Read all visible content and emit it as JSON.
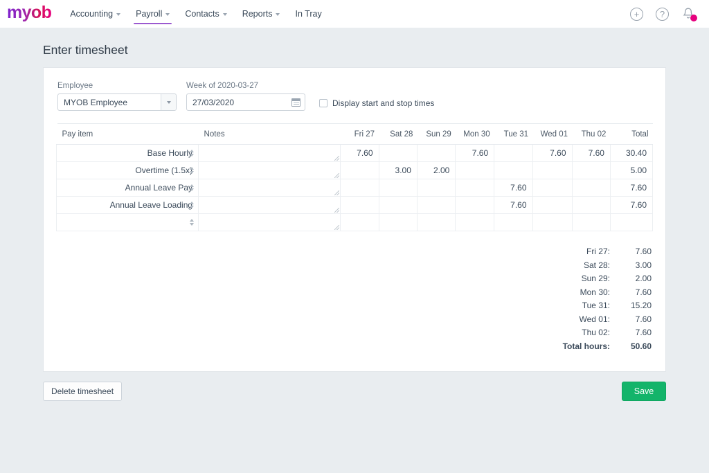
{
  "nav": {
    "logo": "myob",
    "items": [
      {
        "label": "Accounting",
        "has_chevron": true,
        "active": false
      },
      {
        "label": "Payroll",
        "has_chevron": true,
        "active": true
      },
      {
        "label": "Contacts",
        "has_chevron": true,
        "active": false
      },
      {
        "label": "Reports",
        "has_chevron": true,
        "active": false
      },
      {
        "label": "In Tray",
        "has_chevron": false,
        "active": false
      }
    ],
    "add_icon": "+",
    "help_icon": "?",
    "accent_active": "#9b59d0",
    "notification_color": "#e6007e"
  },
  "page": {
    "title": "Enter timesheet"
  },
  "filters": {
    "employee_label": "Employee",
    "employee_value": "MYOB Employee",
    "week_label": "Week of 2020-03-27",
    "date_value": "27/03/2020",
    "date_placeholder": "dd/mm/yyyy",
    "checkbox_label": "Display start and stop times",
    "checkbox_checked": false
  },
  "table": {
    "headers": [
      "Pay item",
      "Notes",
      "Fri 27",
      "Sat 28",
      "Sun 29",
      "Mon 30",
      "Tue 31",
      "Wed 01",
      "Thu 02",
      "Total"
    ],
    "rows": [
      {
        "pay_item": "Base Hourly",
        "notes": "",
        "days": [
          "7.60",
          "",
          "",
          "7.60",
          "",
          "7.60",
          "7.60"
        ],
        "total": "30.40"
      },
      {
        "pay_item": "Overtime (1.5x)",
        "notes": "",
        "days": [
          "",
          "3.00",
          "2.00",
          "",
          "",
          "",
          ""
        ],
        "total": "5.00"
      },
      {
        "pay_item": "Annual Leave Pay",
        "notes": "",
        "days": [
          "",
          "",
          "",
          "",
          "7.60",
          "",
          ""
        ],
        "total": "7.60"
      },
      {
        "pay_item": "Annual Leave Loading",
        "notes": "",
        "days": [
          "",
          "",
          "",
          "",
          "7.60",
          "",
          ""
        ],
        "total": "7.60"
      },
      {
        "pay_item": "",
        "notes": "",
        "days": [
          "",
          "",
          "",
          "",
          "",
          "",
          ""
        ],
        "total": ""
      }
    ]
  },
  "totals": {
    "rows": [
      {
        "label": "Fri 27:",
        "value": "7.60"
      },
      {
        "label": "Sat 28:",
        "value": "3.00"
      },
      {
        "label": "Sun 29:",
        "value": "2.00"
      },
      {
        "label": "Mon 30:",
        "value": "7.60"
      },
      {
        "label": "Tue 31:",
        "value": "15.20"
      },
      {
        "label": "Wed 01:",
        "value": "7.60"
      },
      {
        "label": "Thu 02:",
        "value": "7.60"
      }
    ],
    "grand_label": "Total hours:",
    "grand_value": "50.60"
  },
  "footer": {
    "delete_label": "Delete timesheet",
    "save_label": "Save",
    "save_color": "#13b46a"
  }
}
